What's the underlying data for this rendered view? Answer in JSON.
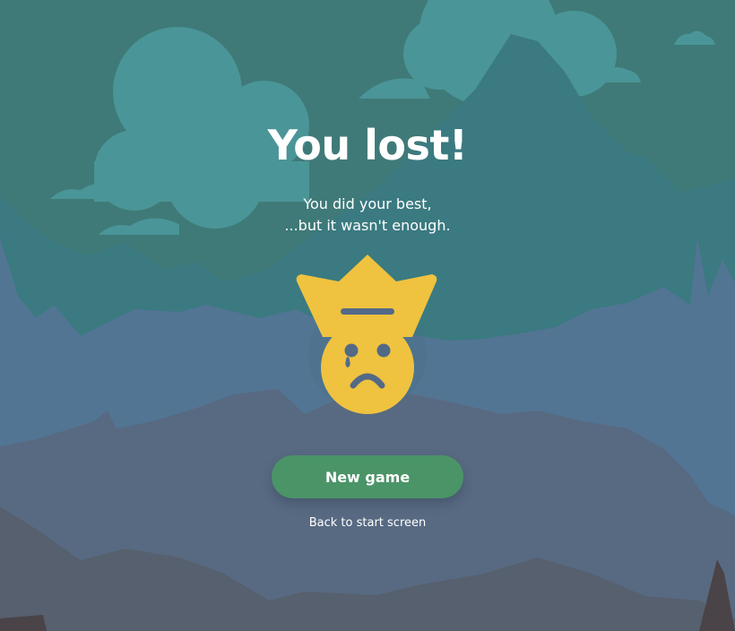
{
  "screen": {
    "title": "You lost!",
    "message_line_1": "You did your best,",
    "message_line_2": "...but it wasn't enough.",
    "emblem": "crying-king-icon"
  },
  "actions": {
    "new_game_label": "New game",
    "back_label": "Back to start screen"
  },
  "colors": {
    "sky": "#3f7a78",
    "cloud": "#4a9597",
    "far_mountain": "#3a7a80",
    "mid_mountain": "#527594",
    "near_hills": "#586a82",
    "foreground": "#56606e",
    "crown_and_face": "#efc23f",
    "button": "#4b9468",
    "text": "#ffffff"
  }
}
